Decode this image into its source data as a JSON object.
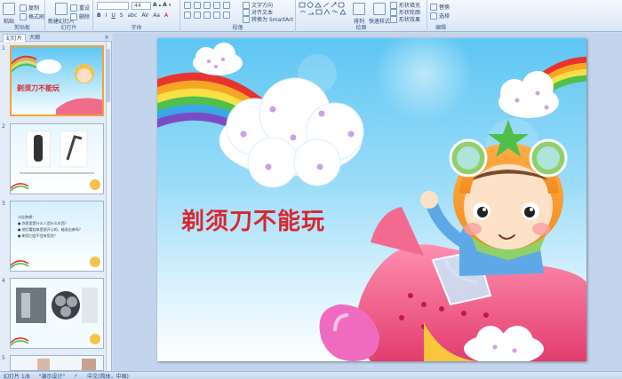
{
  "ribbon": {
    "clipboard": {
      "paste": "粘贴",
      "copy": "复制",
      "format_painter": "格式刷",
      "label": "剪贴板"
    },
    "slides": {
      "new_slide": "新建幻灯片",
      "reset": "重设",
      "delete": "删除",
      "label": "幻灯片"
    },
    "font": {
      "size": "44",
      "label": "字体"
    },
    "paragraph": {
      "text_direction": "文字方向",
      "align_text": "对齐文本",
      "convert_smartart": "转换为 SmartArt",
      "label": "段落"
    },
    "drawing": {
      "arrange": "排列",
      "quick_styles": "快速样式",
      "shape_fill": "形状填充",
      "shape_outline": "形状轮廓",
      "shape_effects": "形状效果",
      "label": "绘图"
    },
    "editing": {
      "replace": "替换",
      "select": "选择",
      "label": "编辑"
    }
  },
  "left_panel": {
    "tabs": [
      "幻灯片",
      "大纲"
    ],
    "slide_numbers": [
      "1",
      "2",
      "3",
      "4",
      "5"
    ],
    "thumb1_title": "剃须刀不能玩",
    "thumb3_lines": [
      "讨论和想：",
      "● 你家里是什么人用什么东西？",
      "● 他们看起来是很开心的，能说出来吗？",
      "● 剃须刀会不会有危险？"
    ]
  },
  "slide": {
    "title": "剃须刀不能玩"
  },
  "status_bar": {
    "slide_info": "幻灯片 1/8",
    "theme": "\"演示设计\"",
    "language": "中文(简体，中国)"
  },
  "colors": {
    "title_red": "#d8262f",
    "ribbon_bg": "#dbe7f6",
    "selected_border": "#f0a23a"
  }
}
